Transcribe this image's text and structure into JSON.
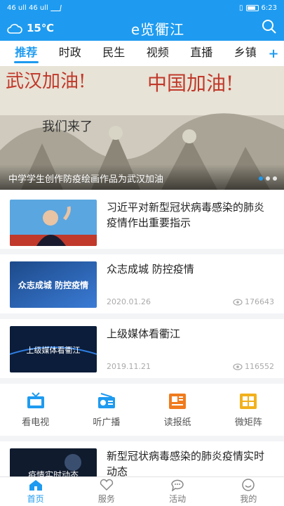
{
  "statusbar": {
    "time": "6:23",
    "left_text": "46 ull 46 ull"
  },
  "appbar": {
    "temperature": "15℃",
    "title": "e览衢江"
  },
  "tabs": [
    {
      "label": "推荐"
    },
    {
      "label": "时政"
    },
    {
      "label": "民生"
    },
    {
      "label": "视频"
    },
    {
      "label": "直播"
    },
    {
      "label": "乡镇"
    }
  ],
  "tab_add": "+",
  "banner": {
    "caption": "中学学生创作防疫绘画作品为武汉加油",
    "art_text_1": "武汉加油!",
    "art_text_2": "中国加油!",
    "art_text_3": "我们来了"
  },
  "news": [
    {
      "title": "习近平对新型冠状病毒感染的肺炎疫情作出重要指示",
      "date": "",
      "views": ""
    },
    {
      "title": "众志成城 防控疫情",
      "date": "2020.01.26",
      "views": "176643",
      "thumb_text": "众志成城 防控疫情"
    },
    {
      "title": "上级媒体看衢江",
      "date": "2019.11.21",
      "views": "116552",
      "thumb_text": "上级媒体看衢江"
    }
  ],
  "services": [
    {
      "label": "看电视",
      "icon": "tv-icon"
    },
    {
      "label": "听广播",
      "icon": "radio-icon"
    },
    {
      "label": "读报纸",
      "icon": "newspaper-icon"
    },
    {
      "label": "微矩阵",
      "icon": "matrix-icon"
    }
  ],
  "news_bottom": {
    "title": "新型冠状病毒感染的肺炎疫情实时动态",
    "thumb_text": "疫情实时动态"
  },
  "bottomnav": [
    {
      "label": "首页",
      "icon": "home-icon"
    },
    {
      "label": "服务",
      "icon": "heart-icon"
    },
    {
      "label": "活动",
      "icon": "chat-icon"
    },
    {
      "label": "我的",
      "icon": "smile-icon"
    }
  ],
  "colors": {
    "brand": "#1e9bf0"
  }
}
